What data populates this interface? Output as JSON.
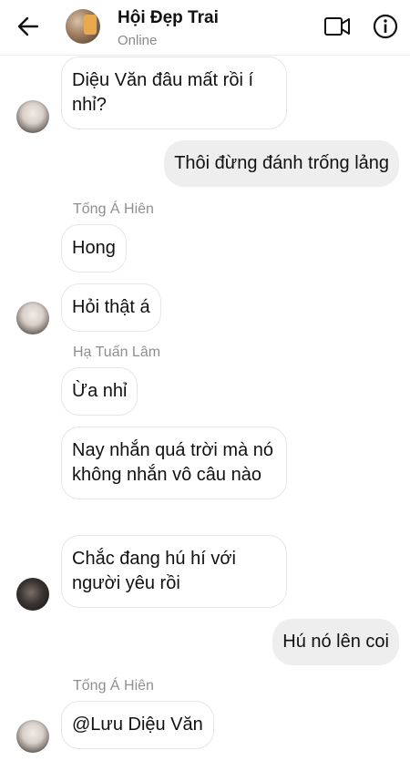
{
  "header": {
    "title": "Hội Đẹp Trai",
    "status": "Online",
    "icons": {
      "back": "arrow-left-icon",
      "video": "video-call-icon",
      "info": "info-icon"
    }
  },
  "colors": {
    "incoming_bubble": "#ffffff",
    "outgoing_bubble": "#eeeeee",
    "sender_text": "#8f8f8f"
  },
  "messages": [
    {
      "direction": "in",
      "text": "Diệu Văn đâu mất rồi í nhỉ?"
    },
    {
      "direction": "out",
      "text": "Thôi đừng đánh trống lảng"
    },
    {
      "direction": "in",
      "sender": "Tống Á Hiên",
      "text": "Hong"
    },
    {
      "direction": "in",
      "text": "Hỏi thật á"
    },
    {
      "direction": "in",
      "sender": "Hạ Tuấn Lâm",
      "text": "Ừa nhỉ"
    },
    {
      "direction": "in",
      "text": "Nay nhắn quá trời mà nó không nhắn vô câu nào"
    },
    {
      "direction": "in",
      "text": "Chắc đang hú hí với người yêu rồi"
    },
    {
      "direction": "out",
      "text": "Hú nó lên coi"
    },
    {
      "direction": "in",
      "sender": "Tống Á Hiên",
      "text": "@Lưu Diệu Văn"
    }
  ]
}
